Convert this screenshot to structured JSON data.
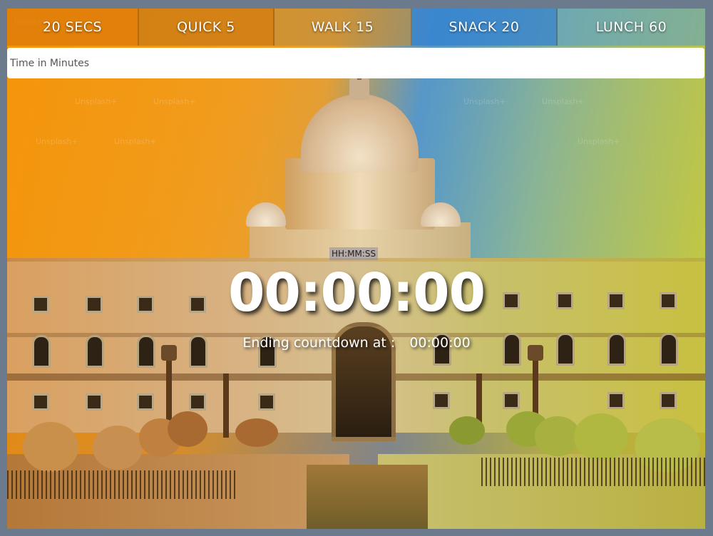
{
  "presets": [
    {
      "label": "20 SECS"
    },
    {
      "label": "QUICK 5"
    },
    {
      "label": "WALK 15"
    },
    {
      "label": "SNACK 20"
    },
    {
      "label": "LUNCH 60"
    }
  ],
  "input": {
    "placeholder": "Time in Minutes",
    "value": ""
  },
  "timer": {
    "format_label": "HH:MM:SS",
    "display": "00:00:00",
    "ending_label": "Ending countdown at :",
    "ending_time": "00:00:00"
  },
  "background": {
    "description_icon": "government-building-photo",
    "watermark": "Unsplash+"
  }
}
